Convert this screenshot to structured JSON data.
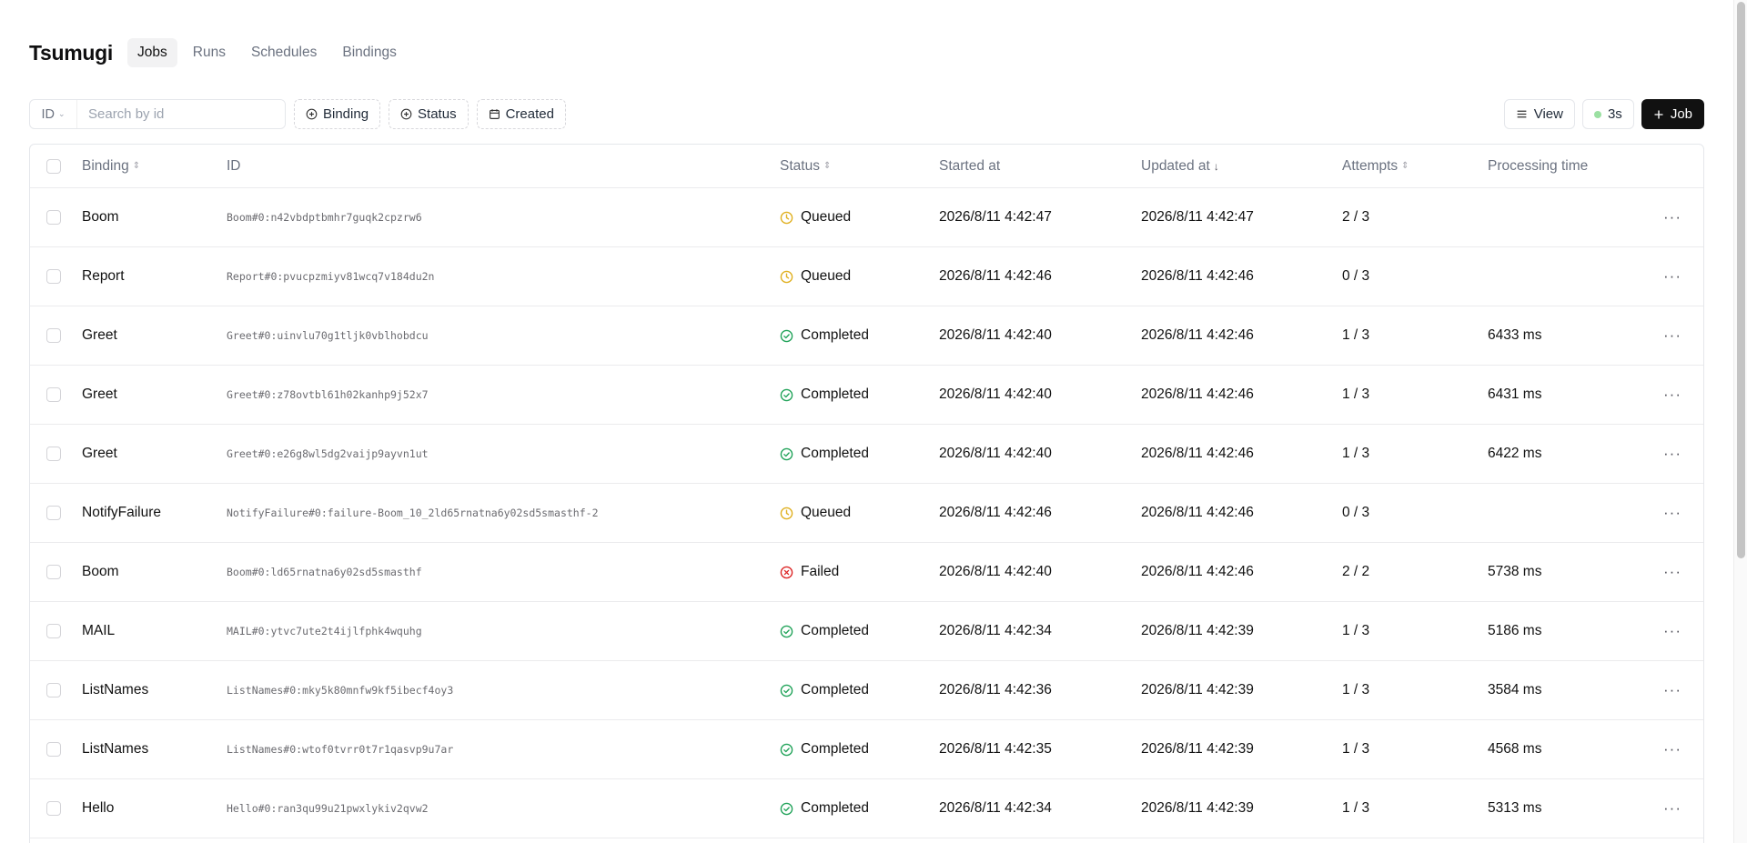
{
  "app": {
    "title": "Tsumugi"
  },
  "nav": [
    "Jobs",
    "Runs",
    "Schedules",
    "Bindings"
  ],
  "toolbar": {
    "id_select": "ID",
    "search_placeholder": "Search by id",
    "filters": [
      "Binding",
      "Status",
      "Created"
    ],
    "view_label": "View",
    "refresh_label": "3s",
    "add_job_label": "Job"
  },
  "colors": {
    "queued": "#e0b021",
    "completed": "#22a35a",
    "failed": "#dc2626",
    "refresh_dot": "#9be0a2",
    "primary_button": "#111111"
  },
  "table": {
    "headers": {
      "binding": "Binding",
      "id": "ID",
      "status": "Status",
      "started": "Started at",
      "updated": "Updated at",
      "attempts": "Attempts",
      "processing": "Processing time"
    },
    "rows": [
      {
        "binding": "Boom",
        "id": "Boom#0:n42vbdptbmhr7guqk2cpzrw6",
        "status": "Queued",
        "started": "2026/8/11 4:42:47",
        "updated": "2026/8/11 4:42:47",
        "attempts": "2 / 3",
        "processing": ""
      },
      {
        "binding": "Report",
        "id": "Report#0:pvucpzmiyv81wcq7v184du2n",
        "status": "Queued",
        "started": "2026/8/11 4:42:46",
        "updated": "2026/8/11 4:42:46",
        "attempts": "0 / 3",
        "processing": ""
      },
      {
        "binding": "Greet",
        "id": "Greet#0:uinvlu70g1tljk0vblhobdcu",
        "status": "Completed",
        "started": "2026/8/11 4:42:40",
        "updated": "2026/8/11 4:42:46",
        "attempts": "1 / 3",
        "processing": "6433 ms"
      },
      {
        "binding": "Greet",
        "id": "Greet#0:z78ovtbl61h02kanhp9j52x7",
        "status": "Completed",
        "started": "2026/8/11 4:42:40",
        "updated": "2026/8/11 4:42:46",
        "attempts": "1 / 3",
        "processing": "6431 ms"
      },
      {
        "binding": "Greet",
        "id": "Greet#0:e26g8wl5dg2vaijp9ayvn1ut",
        "status": "Completed",
        "started": "2026/8/11 4:42:40",
        "updated": "2026/8/11 4:42:46",
        "attempts": "1 / 3",
        "processing": "6422 ms"
      },
      {
        "binding": "NotifyFailure",
        "id": "NotifyFailure#0:failure-Boom_10_2ld65rnatna6y02sd5smasthf-2",
        "status": "Queued",
        "started": "2026/8/11 4:42:46",
        "updated": "2026/8/11 4:42:46",
        "attempts": "0 / 3",
        "processing": ""
      },
      {
        "binding": "Boom",
        "id": "Boom#0:ld65rnatna6y02sd5smasthf",
        "status": "Failed",
        "started": "2026/8/11 4:42:40",
        "updated": "2026/8/11 4:42:46",
        "attempts": "2 / 2",
        "processing": "5738 ms"
      },
      {
        "binding": "MAIL",
        "id": "MAIL#0:ytvc7ute2t4ijlfphk4wquhg",
        "status": "Completed",
        "started": "2026/8/11 4:42:34",
        "updated": "2026/8/11 4:42:39",
        "attempts": "1 / 3",
        "processing": "5186 ms"
      },
      {
        "binding": "ListNames",
        "id": "ListNames#0:mky5k80mnfw9kf5ibecf4oy3",
        "status": "Completed",
        "started": "2026/8/11 4:42:36",
        "updated": "2026/8/11 4:42:39",
        "attempts": "1 / 3",
        "processing": "3584 ms"
      },
      {
        "binding": "ListNames",
        "id": "ListNames#0:wtof0tvrr0t7r1qasvp9u7ar",
        "status": "Completed",
        "started": "2026/8/11 4:42:35",
        "updated": "2026/8/11 4:42:39",
        "attempts": "1 / 3",
        "processing": "4568 ms"
      },
      {
        "binding": "Hello",
        "id": "Hello#0:ran3qu99u21pwxlykiv2qvw2",
        "status": "Completed",
        "started": "2026/8/11 4:42:34",
        "updated": "2026/8/11 4:42:39",
        "attempts": "1 / 3",
        "processing": "5313 ms"
      }
    ]
  }
}
